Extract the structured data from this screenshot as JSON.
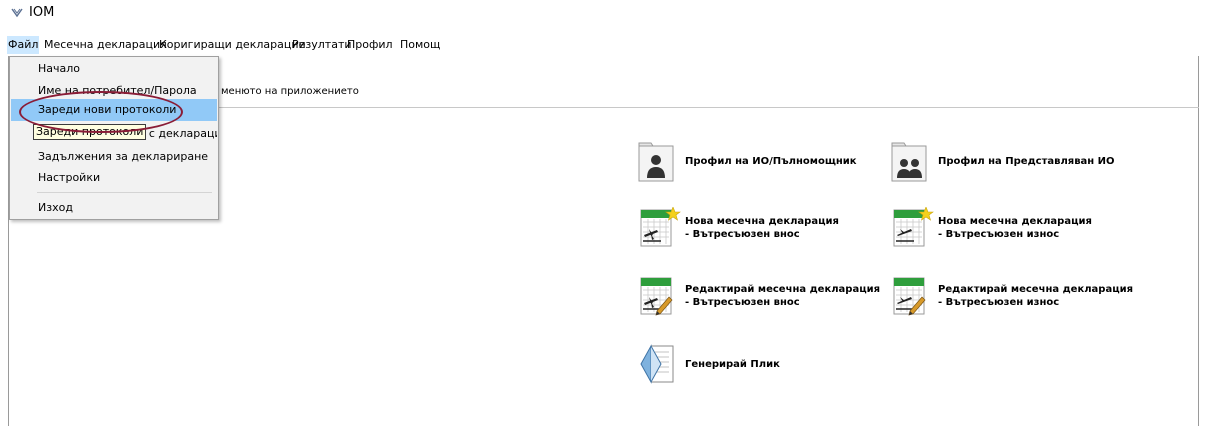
{
  "window": {
    "title": "IOM"
  },
  "menubar": {
    "items": [
      {
        "label": "Файл"
      },
      {
        "label": "Месечна декларация"
      },
      {
        "label": "Коригиращи декларации"
      },
      {
        "label": "Резултати"
      },
      {
        "label": "Профил"
      },
      {
        "label": "Помощ"
      }
    ]
  },
  "hint_text": "менюто на приложението",
  "file_menu": {
    "items": [
      {
        "label": "Начало"
      },
      {
        "label": "Име на потребител/Парола"
      },
      {
        "label": "Зареди нови протоколи"
      },
      {
        "label": "Зареди протоколи с декларации"
      },
      {
        "label": "Задължения за деклариране"
      },
      {
        "label": "Настройки"
      },
      {
        "label": "Изход"
      }
    ],
    "highlighted": "Зареди нови протоколи"
  },
  "tooltip": "Зареди протоколи",
  "tiles": [
    {
      "line1": "Профил на ИО/Пълномощник",
      "line2": "",
      "icon": "user-profile-icon"
    },
    {
      "line1": "Профил на Представляван ИО",
      "line2": "",
      "icon": "group-profile-icon"
    },
    {
      "line1": "Нова месечна декларация",
      "line2": "- Вътресъюзен внос",
      "icon": "new-import-declaration-icon"
    },
    {
      "line1": "Нова месечна декларация",
      "line2": "- Вътресъюзен износ",
      "icon": "new-export-declaration-icon"
    },
    {
      "line1": "Редактирай месечна декларация",
      "line2": "- Вътресъюзен внос",
      "icon": "edit-import-declaration-icon"
    },
    {
      "line1": "Редактирай месечна декларация",
      "line2": "- Вътресъюзен износ",
      "icon": "edit-export-declaration-icon"
    },
    {
      "line1": "Генерирай Плик",
      "line2": "",
      "icon": "generate-envelope-icon"
    }
  ],
  "colors": {
    "menu_highlight": "#91c9f7",
    "annotation_circle": "#8a1c36",
    "tooltip_bg": "#ffffe1",
    "calendar_green": "#2e9e3c",
    "star_yellow": "#f4d11c"
  }
}
